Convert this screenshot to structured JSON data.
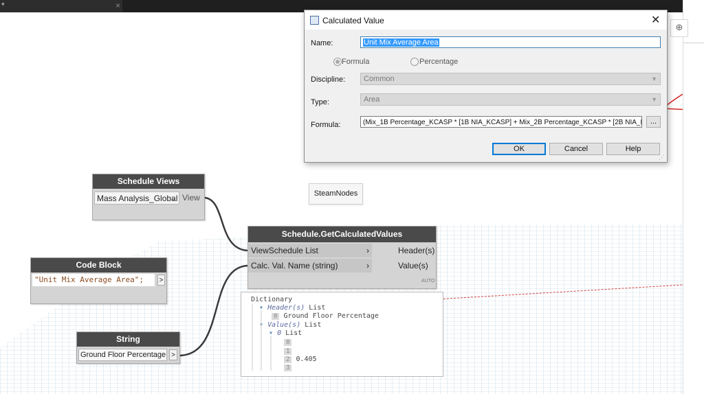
{
  "tab": {
    "marker": "*",
    "close": "×"
  },
  "dialog": {
    "title": "Calculated Value",
    "close": "✕",
    "name_label": "Name:",
    "name_value": "Unit Mix Average Area",
    "formula_radio": "Formula",
    "percentage_radio": "Percentage",
    "discipline_label": "Discipline:",
    "discipline_value": "Common",
    "type_label": "Type:",
    "type_value": "Area",
    "formula_label": "Formula:",
    "formula_value": "(Mix_1B Percentage_KCASP * [1B NIA_KCASP] + Mix_2B Percentage_KCASP * [2B NIA_KCASP]",
    "browse": "...",
    "ok": "OK",
    "cancel": "Cancel",
    "help": "Help"
  },
  "nodes": {
    "schedule_views": {
      "title": "Schedule Views",
      "dropdown": "Mass Analysis_Global",
      "port": "View"
    },
    "get_calc": {
      "title": "Schedule.GetCalculatedValues",
      "in1": "ViewSchedule List",
      "in2": "Calc. Val. Name (string)",
      "out1": "Header(s)",
      "out2": "Value(s)",
      "lacing": "AUTO"
    },
    "code_block": {
      "title": "Code Block",
      "code": "\"Unit Mix Average Area\";",
      "port": ">"
    },
    "string": {
      "title": "String",
      "value": "Ground Floor Percentage",
      "port": ">"
    },
    "steam": {
      "label": "SteamNodes"
    }
  },
  "watch": {
    "root": "Dictionary",
    "header_key": "Header(s)",
    "list": "List",
    "header_idx": "0",
    "header_val": "Ground Floor Percentage",
    "value_key": "Value(s)",
    "value_list_idx": "0",
    "idx0": "0",
    "idx1": "1",
    "idx2": "2",
    "idx3": "3",
    "val2": "0.405"
  },
  "colors": {
    "node_header": "#4a4a4a",
    "annotation": "#d62828",
    "grid": "#a9c3d8"
  }
}
